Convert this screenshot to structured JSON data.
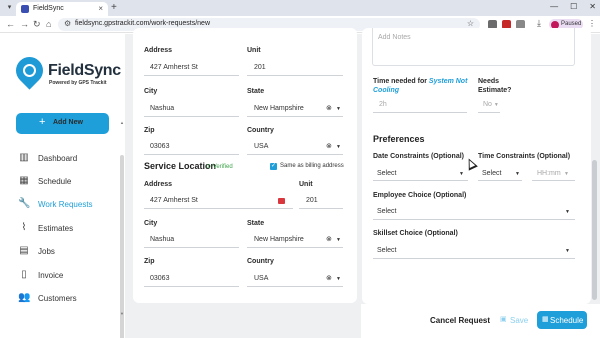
{
  "browser": {
    "tab_title": "FieldSync",
    "url": "fieldsync.gpstrackit.com/work-requests/new",
    "profile_status": "Paused"
  },
  "sidebar": {
    "logo_name": "FieldSync",
    "logo_tagline": "Powered by GPS Trackit",
    "add_new_label": "Add New",
    "items": [
      {
        "label": "Dashboard",
        "icon": "bar-chart-icon"
      },
      {
        "label": "Schedule",
        "icon": "calendar-icon"
      },
      {
        "label": "Work Requests",
        "icon": "wrench-icon"
      },
      {
        "label": "Estimates",
        "icon": "paperclip-icon"
      },
      {
        "label": "Jobs",
        "icon": "clipboard-icon"
      },
      {
        "label": "Invoice",
        "icon": "document-icon"
      },
      {
        "label": "Customers",
        "icon": "people-icon"
      }
    ],
    "active_item": "Work Requests"
  },
  "billing": {
    "address_label": "Address",
    "address_value": "427 Amherst St",
    "unit_label": "Unit",
    "unit_value": "201",
    "city_label": "City",
    "city_value": "Nashua",
    "state_label": "State",
    "state_value": "New Hampshire",
    "zip_label": "Zip",
    "zip_value": "03063",
    "country_label": "Country",
    "country_value": "USA"
  },
  "service_location": {
    "title": "Service Location",
    "verified_label": "Verified",
    "same_as_billing_label": "Same as billing address",
    "same_as_billing_checked": true,
    "address_label": "Address",
    "address_value": "427 Amherst St",
    "unit_label": "Unit",
    "unit_value": "201",
    "city_label": "City",
    "city_value": "Nashua",
    "state_label": "State",
    "state_value": "New Hampshire",
    "zip_label": "Zip",
    "zip_value": "03063",
    "country_label": "Country",
    "country_value": "USA"
  },
  "right_panel": {
    "notes_placeholder": "Add Notes",
    "time_needed_prefix": "Time needed for",
    "time_needed_highlight": "System Not Cooling",
    "time_needed_value": "2h",
    "needs_estimate_label": "Needs Estimate?",
    "needs_estimate_value": "No",
    "preferences_title": "Preferences",
    "date_constraints_label": "Date Constraints (Optional)",
    "date_constraints_value": "Select",
    "time_constraints_label": "Time Constraints (Optional)",
    "time_constraints_value": "Select",
    "time_placeholder": "HH:mm",
    "employee_choice_label": "Employee Choice (Optional)",
    "employee_choice_value": "Select",
    "skillset_choice_label": "Skillset Choice (Optional)",
    "skillset_choice_value": "Select"
  },
  "footer": {
    "cancel_label": "Cancel Request",
    "save_label": "Save",
    "schedule_label": "Schedule"
  },
  "colors": {
    "accent": "#1f9fd9",
    "verified": "#3fa34d"
  }
}
